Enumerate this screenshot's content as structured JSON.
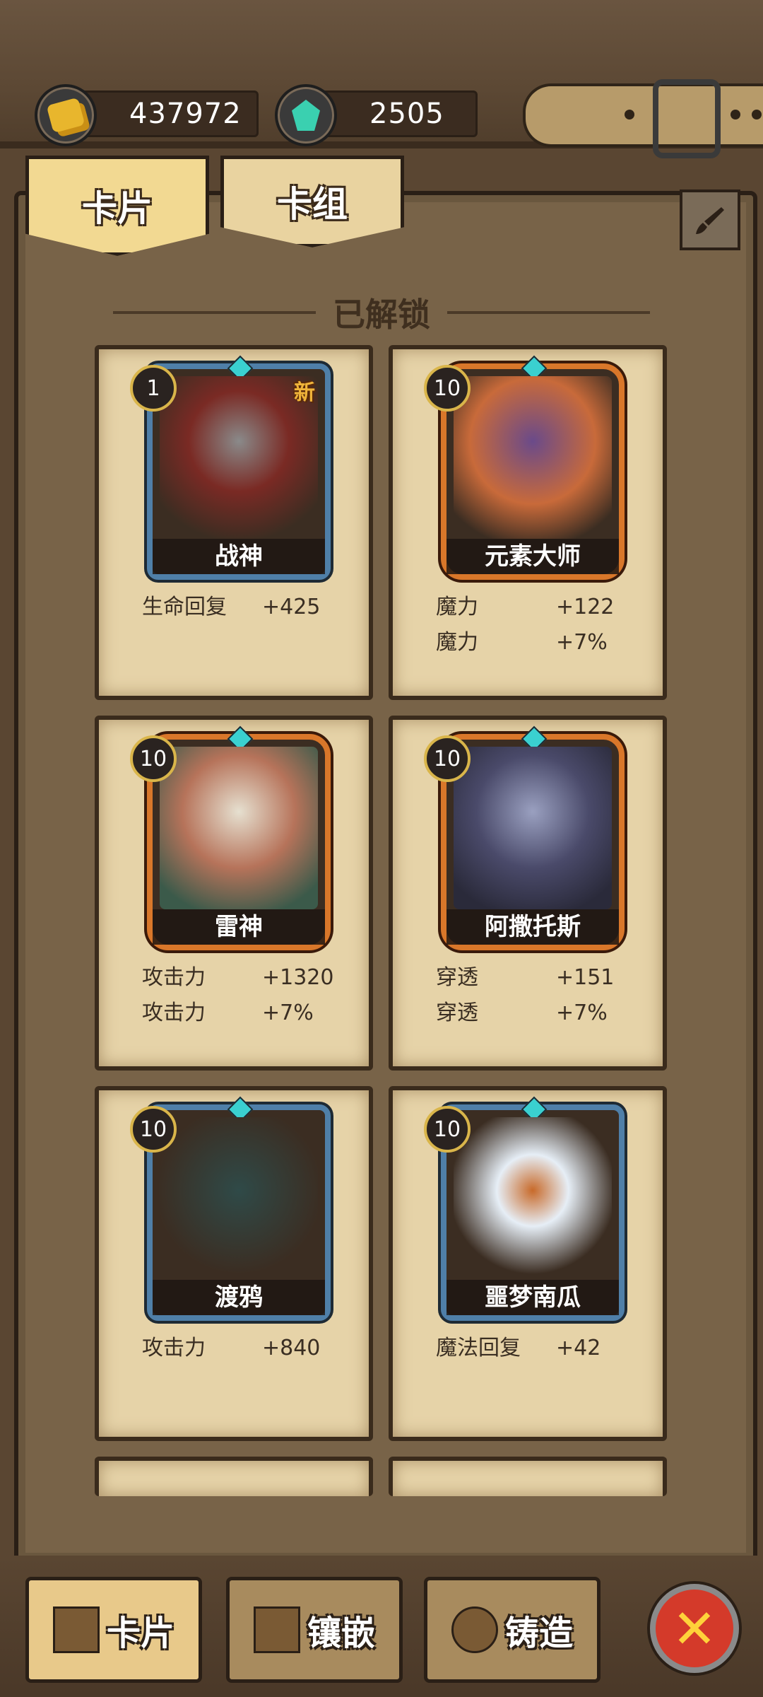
{
  "currency": {
    "gold": "437972",
    "gems": "2505"
  },
  "tabs": [
    {
      "label": "卡片",
      "active": true
    },
    {
      "label": "卡组",
      "active": false
    }
  ],
  "section_title": "已解锁",
  "cards": [
    {
      "name": "战神",
      "level": "1",
      "new_label": "新",
      "frame": "blue",
      "stats": [
        {
          "label": "生命回复",
          "value": "+425"
        }
      ]
    },
    {
      "name": "元素大师",
      "level": "10",
      "frame": "orange",
      "stats": [
        {
          "label": "魔力",
          "value": "+122"
        },
        {
          "label": "魔力",
          "value": "+7%"
        }
      ]
    },
    {
      "name": "雷神",
      "level": "10",
      "frame": "orange",
      "stats": [
        {
          "label": "攻击力",
          "value": "+1320"
        },
        {
          "label": "攻击力",
          "value": "+7%"
        }
      ]
    },
    {
      "name": "阿撒托斯",
      "level": "10",
      "frame": "orange",
      "stats": [
        {
          "label": "穿透",
          "value": "+151"
        },
        {
          "label": "穿透",
          "value": "+7%"
        }
      ]
    },
    {
      "name": "渡鸦",
      "level": "10",
      "frame": "blue",
      "stats": [
        {
          "label": "攻击力",
          "value": "+840"
        }
      ]
    },
    {
      "name": "噩梦南瓜",
      "level": "10",
      "frame": "blue",
      "stats": [
        {
          "label": "魔法回复",
          "value": "+42"
        }
      ]
    }
  ],
  "bottom_nav": [
    {
      "label": "卡片",
      "active": true
    },
    {
      "label": "镶嵌",
      "active": false
    },
    {
      "label": "铸造",
      "active": false
    }
  ],
  "close_symbol": "✕"
}
